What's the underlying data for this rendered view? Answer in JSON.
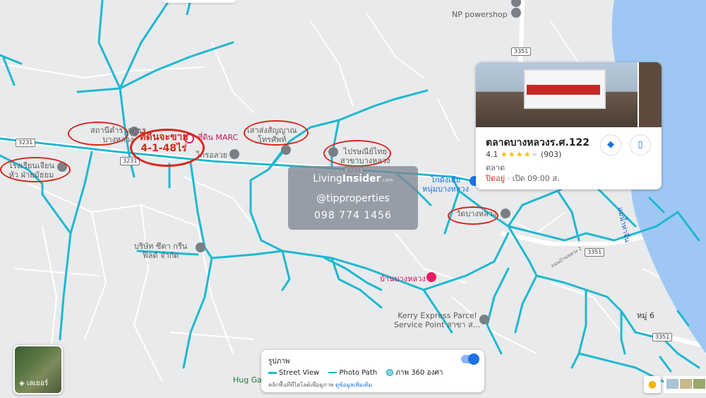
{
  "map": {
    "accent_road": "#1fb8d0",
    "water": "#9ec8f3",
    "background": "#e9eaec"
  },
  "places": {
    "np_powershop": "NP powershop",
    "police_station": "สถานีตำรวจภูธร\nบางหลวง",
    "school": "โรงเรียนเจียน\nหัว ฝ่ายมัธยม",
    "marc_land": "ที่ดิน MARC",
    "krolaluay": "ไกรอลวย",
    "signal_post": "เสาส่งสัญญาณ\nโทรศัพท์",
    "post_office": "ไปรษณีย์ไทย\nสาขาบางหลวง",
    "hotel": "โกดังเฮีย\nหนุ่มบางหลวง",
    "temple": "วัดบางหลวง",
    "company": "บริษัท ซีตา กรีน\nฟิลด์ จำกัด",
    "ban_bang_luang": "บ้านบางหลวง",
    "kerry": "Kerry Express Parcel\nService Point สาขา ส...",
    "village": "หมู่ 6",
    "hug": "Hug Ga",
    "river": "แม่น้ำท่าจีน",
    "road_label": "ถนนบ้านหลวง 2"
  },
  "annotation": {
    "sale_text": "ที่ดินจะขาย\n4-1-48ไร่"
  },
  "watermark": {
    "brand_a": "Living",
    "brand_b": "Insider",
    "brand_c": ".com",
    "handle": "@tipproperties",
    "phone": "098 774 1456"
  },
  "route_shields": {
    "r3231_west": "3231",
    "r3231_mid": "3231",
    "r3231_east": "3231",
    "r3351_top": "3351",
    "r3351_mid": "3351",
    "r3351_bottom": "3351"
  },
  "place_card": {
    "title": "ตลาดบางหลวงร.ศ.122",
    "rating": "4.1",
    "stars": "★★★★",
    "star_empty": "★",
    "reviews": "(903)",
    "category": "ตลาด",
    "status": "ปิดอยู่",
    "sep": " · ",
    "hours": "เปิด 09:00 ส."
  },
  "layers": {
    "label": "เลเยอร์"
  },
  "legend": {
    "heading": "รูปภาพ",
    "street_view": "Street View",
    "photo_path": "Photo Path",
    "photo_360": "ภาพ 360 องศา",
    "note": "คลิกพื้นที่ที่ไฮไลต์เพื่อดูภาพ",
    "more_link": "ดูข้อมูลเพิ่มเติม"
  }
}
